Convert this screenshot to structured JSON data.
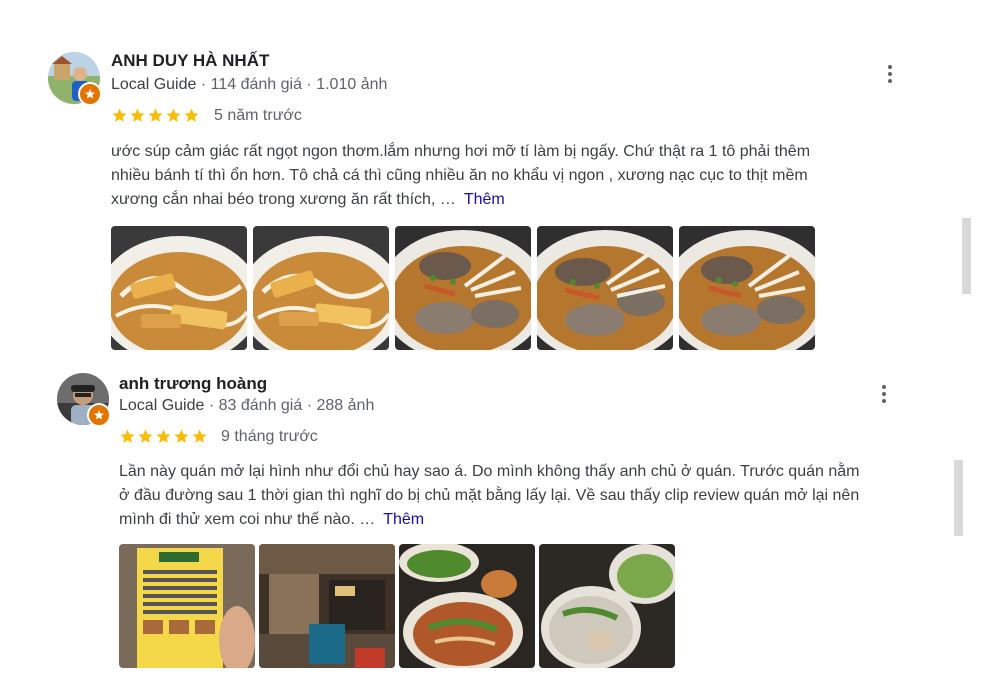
{
  "reviews": [
    {
      "name": "ANH DUY HÀ NHẤT",
      "guide": "Local Guide",
      "reviews_count": "114 đánh giá",
      "photos_count": "1.010 ảnh",
      "rating": 5,
      "time": "5 năm trước",
      "lines": [
        "ước súp cảm giác rất ngọt ngon thơm.lắm nhưng hơi mỡ tí làm bị ngấy. Chứ thật ra 1 tô phải thêm",
        "nhiều bánh tí thì ổn hơn. Tô chả cá thì cũng nhiều ăn no khẩu vị ngon , xương nạc cục to thịt mềm",
        "xương cắn nhai béo trong xương ăn rất thích, …"
      ],
      "more_label": "Thêm",
      "photos": [
        "noodle-soup-fishcake-photo",
        "noodle-soup-fishcake-photo",
        "noodle-soup-meat-photo",
        "noodle-soup-meat-photo",
        "noodle-soup-meat-photo"
      ]
    },
    {
      "name": "anh trương hoàng",
      "guide": "Local Guide",
      "reviews_count": "83 đánh giá",
      "photos_count": "288 ảnh",
      "rating": 5,
      "time": "9 tháng trước",
      "lines": [
        "Lần này quán mở lại hình như đổi chủ hay sao á. Do mình không thấy anh chủ ở quán. Trước quán nằm",
        "ở đầu đường sau 1 thời gian thì nghĩ do bị chủ mặt bằng lấy lại. Về sau thấy clip review quán mở lại nên",
        "mình đi thử xem coi như thế nào. …"
      ],
      "more_label": "Thêm",
      "photos": [
        "menu-photo",
        "shop-front-photo",
        "noodle-bowl-photo",
        "soup-bowls-photo"
      ]
    }
  ],
  "colors": {
    "star": "#fbbc04",
    "link": "#1a0dab",
    "guide_badge": "#e37400",
    "meta": "#5f6368"
  },
  "icons": [
    "star-icon",
    "more-vert-icon",
    "local-guide-badge-icon"
  ]
}
